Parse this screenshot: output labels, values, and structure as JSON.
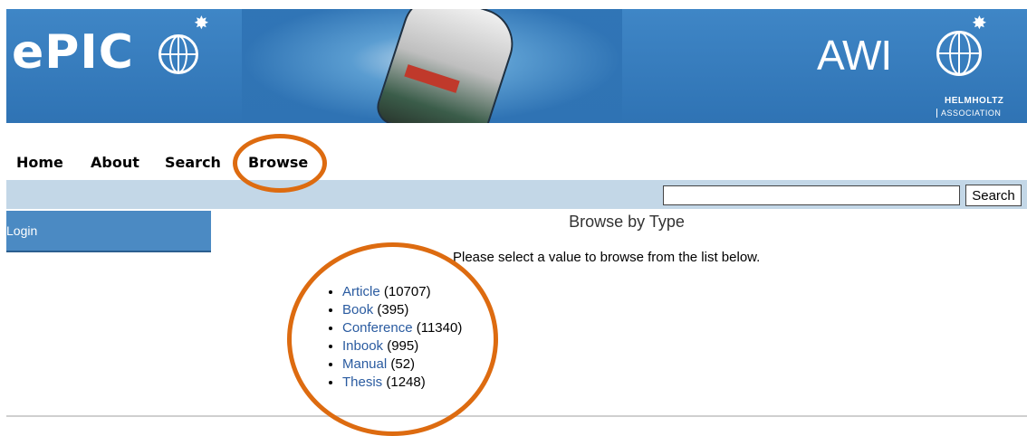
{
  "banner": {
    "logo_text": "ePIC",
    "partner_logo_text": "AWI",
    "partner_sub1": "HELMHOLTZ",
    "partner_sub2": "ASSOCIATION"
  },
  "nav": {
    "items": [
      {
        "label": "Home"
      },
      {
        "label": "About"
      },
      {
        "label": "Search"
      },
      {
        "label": "Browse"
      }
    ]
  },
  "toolbar": {
    "search_value": "",
    "search_button_label": "Search"
  },
  "sidebar": {
    "login_label": "Login"
  },
  "main": {
    "title": "Browse by Type",
    "intro": "Please select a value to browse from the list below.",
    "types": [
      {
        "label": "Article",
        "count": "(10707)"
      },
      {
        "label": "Book",
        "count": "(395)"
      },
      {
        "label": "Conference",
        "count": "(11340)"
      },
      {
        "label": "Inbook",
        "count": "(995)"
      },
      {
        "label": "Manual",
        "count": "(52)"
      },
      {
        "label": "Thesis",
        "count": "(1248)"
      }
    ]
  },
  "colors": {
    "banner": "#3a80c0",
    "toolbar": "#c3d7e7",
    "sidebar": "#4b8ac3",
    "link": "#2a5ba0",
    "annotation": "#dd6b10"
  }
}
